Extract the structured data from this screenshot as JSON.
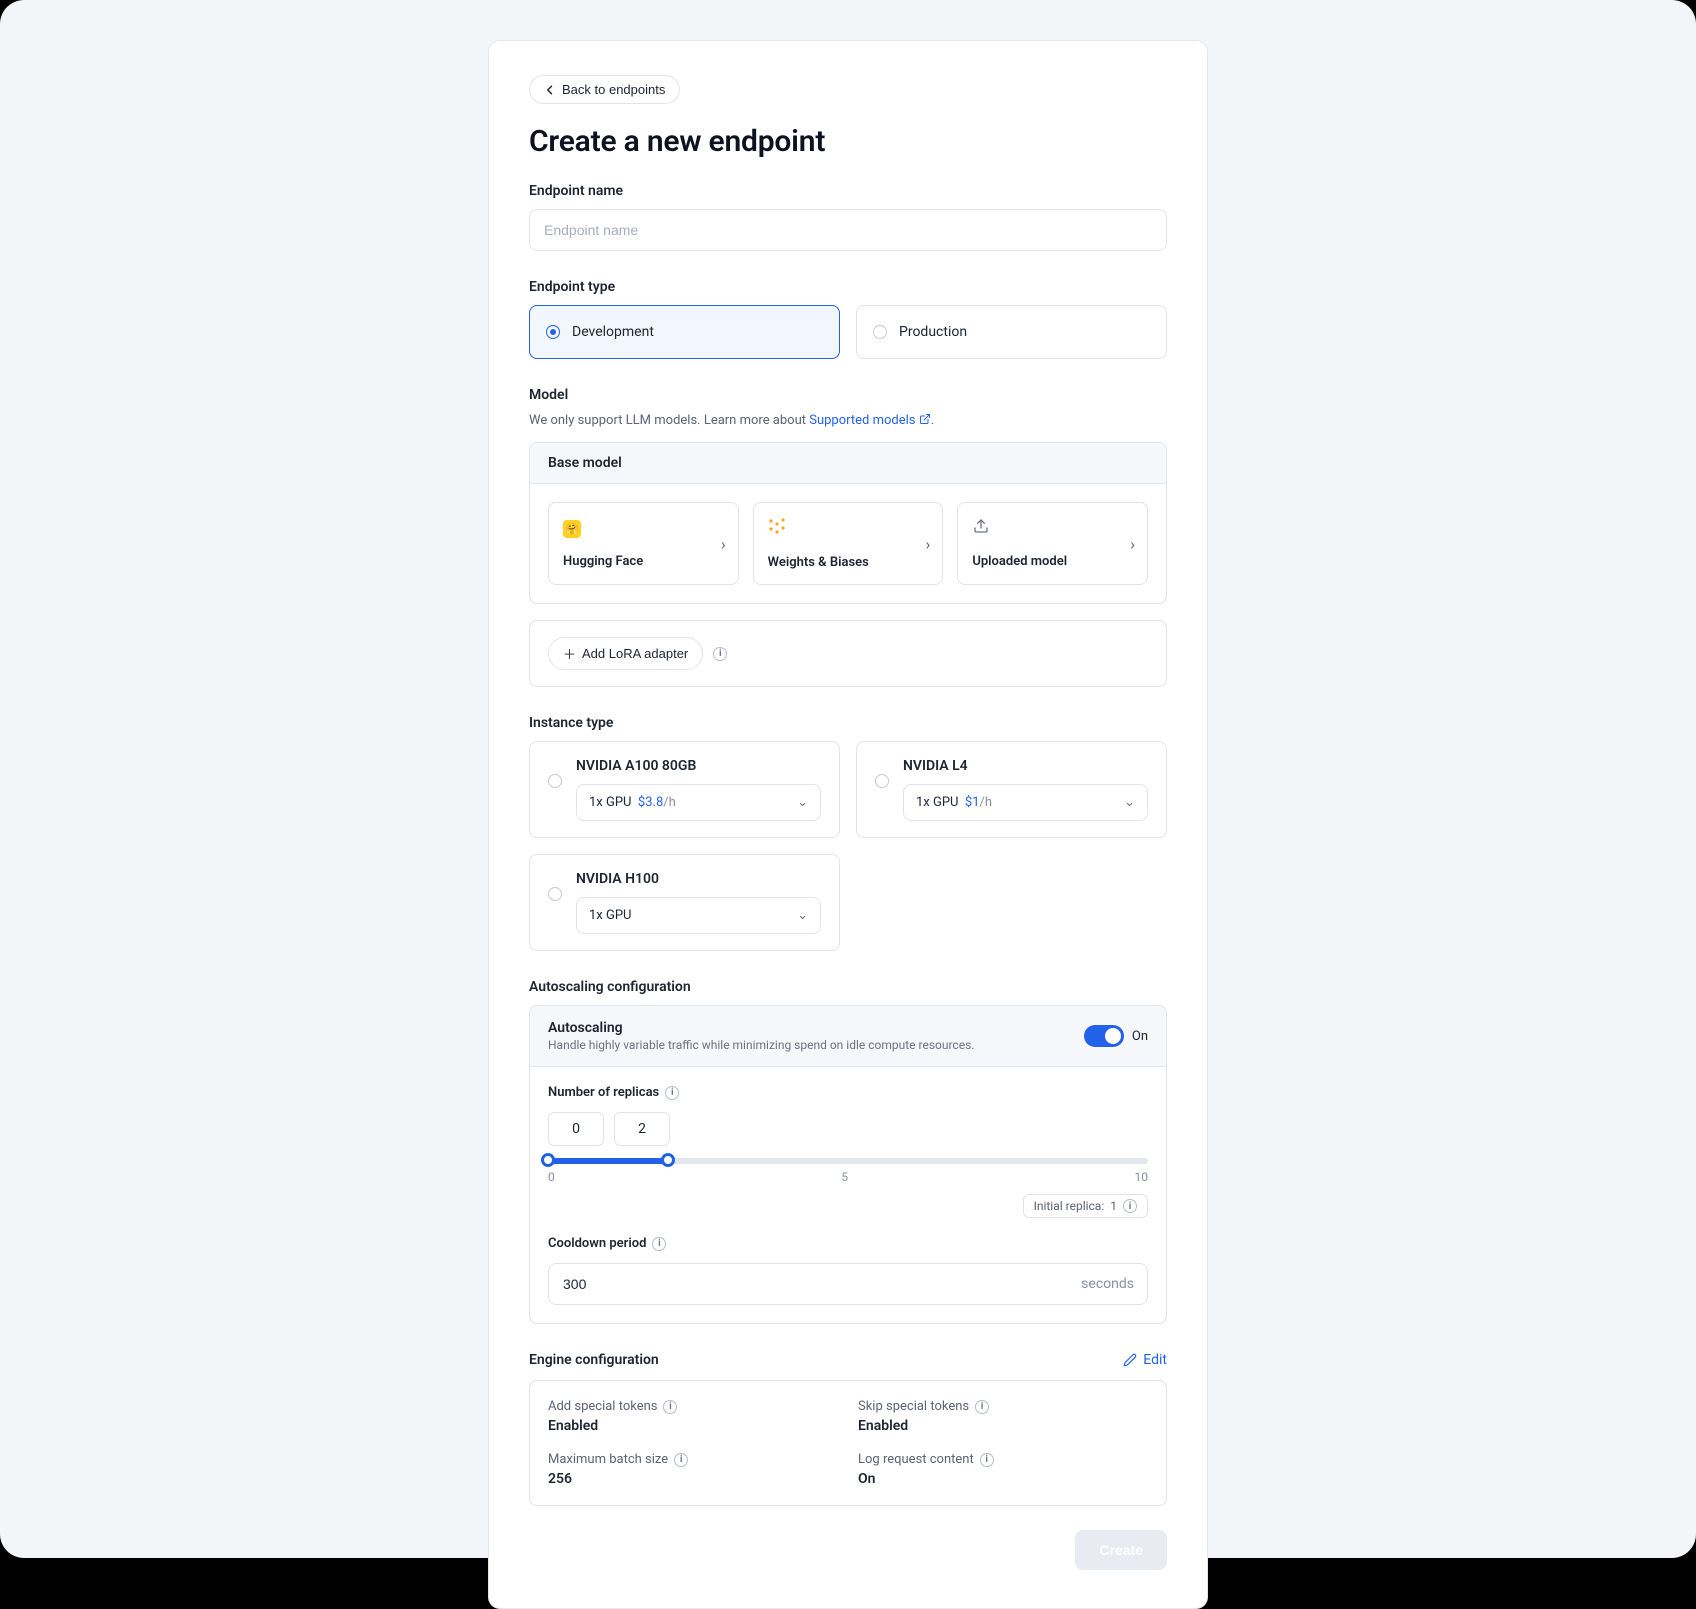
{
  "back_label": "Back to endpoints",
  "page_title": "Create a new endpoint",
  "endpoint_name": {
    "label": "Endpoint name",
    "placeholder": "Endpoint name"
  },
  "endpoint_type": {
    "label": "Endpoint type",
    "options": [
      "Development",
      "Production"
    ],
    "selected_index": 0
  },
  "model": {
    "label": "Model",
    "hint_prefix": "We only support LLM models. Learn more about ",
    "hint_link": "Supported models",
    "hint_suffix": ".",
    "base_model_header": "Base model",
    "sources": [
      {
        "name": "Hugging Face",
        "icon": "huggingface"
      },
      {
        "name": "Weights & Biases",
        "icon": "wandb"
      },
      {
        "name": "Uploaded model",
        "icon": "upload"
      }
    ],
    "add_lora_label": "Add LoRA adapter"
  },
  "instance": {
    "label": "Instance type",
    "cards": [
      {
        "name": "NVIDIA A100 80GB",
        "gpu": "1x GPU",
        "price": "$3.8",
        "per": "/h"
      },
      {
        "name": "NVIDIA L4",
        "gpu": "1x GPU",
        "price": "$1",
        "per": "/h"
      },
      {
        "name": "NVIDIA H100",
        "gpu": "1x GPU",
        "price": "",
        "per": ""
      }
    ]
  },
  "autoscale": {
    "section_label": "Autoscaling configuration",
    "title": "Autoscaling",
    "subtitle": "Handle highly variable traffic while minimizing spend on idle compute resources.",
    "toggle_label": "On",
    "replicas_label": "Number of replicas",
    "min": 0,
    "max": 2,
    "track_min": 0,
    "track_mid": 5,
    "track_max": 10,
    "initial_replica_label": "Initial replica:",
    "initial_replica_value": 1,
    "cooldown_label": "Cooldown period",
    "cooldown_value": "300",
    "cooldown_unit": "seconds"
  },
  "engine": {
    "section_label": "Engine configuration",
    "edit_label": "Edit",
    "items": [
      {
        "label": "Add special tokens",
        "value": "Enabled"
      },
      {
        "label": "Skip special tokens",
        "value": "Enabled"
      },
      {
        "label": "Maximum batch size",
        "value": "256"
      },
      {
        "label": "Log request content",
        "value": "On"
      }
    ]
  },
  "create_label": "Create"
}
